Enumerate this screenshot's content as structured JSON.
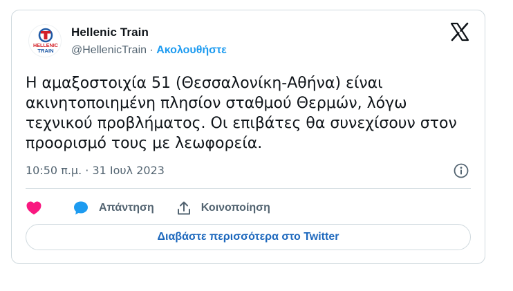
{
  "account": {
    "name": "Hellenic Train",
    "handle": "@HellenicTrain",
    "separator": " · ",
    "follow_label": "Ακολουθήστε",
    "avatar_text_top": "HELLENIC",
    "avatar_text_bottom": "TRAIN"
  },
  "tweet": {
    "text": "Η αμαξοστοιχία 51 (Θεσσαλονίκη-Αθήνα) είναι ακινητοποιημένη πλησίον σταθμού Θερμών, λόγω τεχνικού προβλήματος. Οι επιβάτες θα συνεχίσουν στον προορισμό τους με λεωφορεία.",
    "timestamp": "10:50 π.μ. · 31 Ιουλ 2023"
  },
  "actions": {
    "like_icon": "heart-icon",
    "reply_label": "Απάντηση",
    "reply_icon": "speech-bubble-icon",
    "share_label": "Κοινοποίηση",
    "share_icon": "share-icon"
  },
  "read_more_label": "Διαβάστε περισσότερα στο Twitter",
  "colors": {
    "accent": "#1d9bf0",
    "link_button": "#1d68bd",
    "heart": "#f91880",
    "border": "#cfd9de",
    "muted": "#536471",
    "avatar_red": "#d32027",
    "avatar_blue": "#1f5aa6"
  }
}
